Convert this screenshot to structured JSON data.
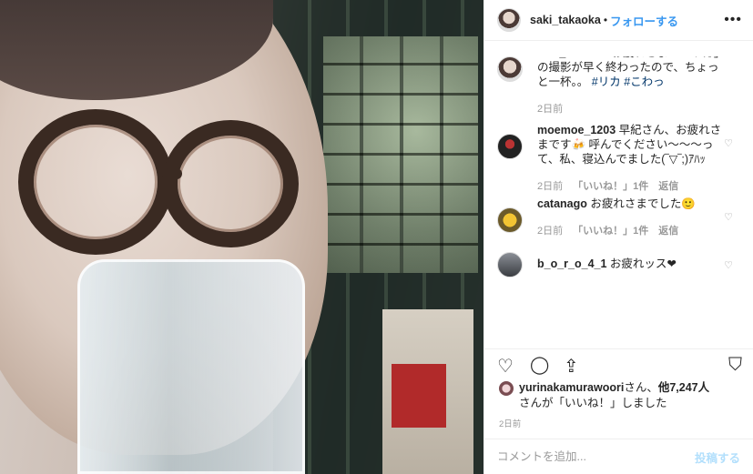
{
  "header": {
    "username": "saki_takaoka",
    "separator": "•",
    "follow_label": "フォローする",
    "more_icon": "more-horizontal-icon",
    "more_glyph": "•••"
  },
  "caption": {
    "username": "saki_takaoka",
    "text": "お疲れさまー「リカ」の撮影が早く終わったので、ちょっと一杯。。",
    "tags": [
      "#リカ",
      "#こわっ"
    ],
    "time": "2日前"
  },
  "comments": [
    {
      "username": "moemoe_1203",
      "text": "早紀さん、お疲れさまです🍻 呼んでください〜〜〜って、私、寝込んでました(‾▽‾;)ｱﾊｯ",
      "time": "2日前",
      "likes": "「いいね！」1件",
      "reply": "返信",
      "heart_glyph": "♡"
    },
    {
      "username": "catanago",
      "text": "お疲れさまでした🙂",
      "time": "2日前",
      "likes": "「いいね！」1件",
      "reply": "返信",
      "heart_glyph": "♡"
    },
    {
      "username": "b_o_r_o_4_1",
      "text": "お疲れッス❤",
      "time": "",
      "likes": "",
      "reply": "",
      "heart_glyph": "♡"
    }
  ],
  "actions": {
    "like_icon": "heart-icon",
    "comment_icon": "comment-icon",
    "share_icon": "share-icon",
    "save_icon": "bookmark-icon",
    "like_glyph": "♡",
    "comment_glyph": "◯",
    "share_glyph": "⇪",
    "save_glyph": "⛉"
  },
  "likes": {
    "first_user": "yurinakamurawoori",
    "suffix1": "さん、",
    "others": "他7,247人",
    "suffix2": "さんが「いいね！」しました"
  },
  "post_time": "2日前",
  "add_comment": {
    "placeholder": "コメントを追加...",
    "post_label": "投稿する"
  }
}
